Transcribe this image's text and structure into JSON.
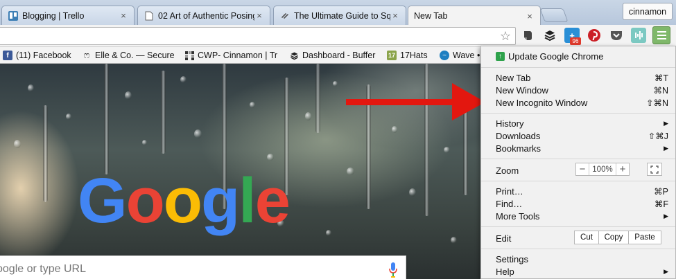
{
  "tabs": [
    {
      "title": "Blogging | Trello",
      "icon": "trello-icon"
    },
    {
      "title": "02 Art of Authentic Posing",
      "icon": "document-icon"
    },
    {
      "title": "The Ultimate Guide to Squ",
      "icon": "squarespace-icon"
    },
    {
      "title": "New Tab",
      "icon": "none",
      "active": true
    }
  ],
  "tab_close_glyph": "×",
  "profile_name": "cinnamon",
  "extensions": {
    "badge_count": "96"
  },
  "bookmarks": [
    {
      "label": "(11) Facebook",
      "icon": "facebook-icon"
    },
    {
      "label": "Elle & Co. — Secure",
      "icon": "mustache-icon"
    },
    {
      "label": "CWP- Cinnamon | Tr",
      "icon": "grid-icon"
    },
    {
      "label": "Dashboard - Buffer",
      "icon": "buffer-icon"
    },
    {
      "label": "17Hats",
      "icon": "17hats-icon"
    },
    {
      "label": "Wave •",
      "icon": "wave-icon"
    }
  ],
  "logo": {
    "letters": [
      "G",
      "o",
      "o",
      "g",
      "l",
      "e"
    ],
    "colors": [
      "#4285f4",
      "#ea4335",
      "#fbbc05",
      "#4285f4",
      "#34a853",
      "#ea4335"
    ]
  },
  "search": {
    "placeholder": "oogle or type URL"
  },
  "menu": {
    "update": "Update Google Chrome",
    "new_tab": {
      "label": "New Tab",
      "shortcut": "⌘T"
    },
    "new_window": {
      "label": "New Window",
      "shortcut": "⌘N"
    },
    "new_incognito": {
      "label": "New Incognito Window",
      "shortcut": "⇧⌘N"
    },
    "history": {
      "label": "History"
    },
    "downloads": {
      "label": "Downloads",
      "shortcut": "⇧⌘J"
    },
    "bookmarks": {
      "label": "Bookmarks"
    },
    "zoom": {
      "label": "Zoom",
      "minus": "−",
      "value": "100%",
      "plus": "+"
    },
    "print": {
      "label": "Print…",
      "shortcut": "⌘P"
    },
    "find": {
      "label": "Find…",
      "shortcut": "⌘F"
    },
    "more_tools": {
      "label": "More Tools"
    },
    "edit": {
      "label": "Edit",
      "cut": "Cut",
      "copy": "Copy",
      "paste": "Paste"
    },
    "settings": {
      "label": "Settings"
    },
    "help": {
      "label": "Help"
    },
    "submenu_glyph": "▶"
  },
  "colors": {
    "menu_button": "#7fb86a",
    "annotation_arrow": "#e3170f",
    "update_icon": "#2ea24b"
  }
}
